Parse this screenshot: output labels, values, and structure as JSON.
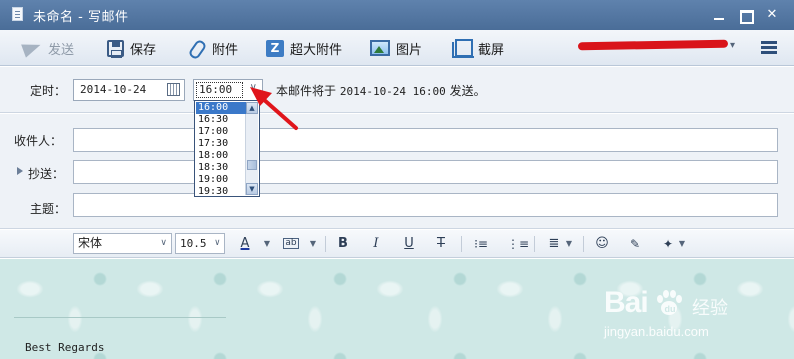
{
  "window": {
    "title": "未命名 - 写邮件"
  },
  "toolbar": {
    "send_label": "发送",
    "save_label": "保存",
    "attach_label": "附件",
    "big_attach_label": "超大附件",
    "picture_label": "图片",
    "screenshot_label": "截屏",
    "big_attach_glyph": "Z"
  },
  "schedule": {
    "label": "定时：",
    "date": "2014-10-24",
    "time": "16:00",
    "note_prefix": "本邮件将于 ",
    "note_datetime": "2014-10-24 16:00",
    "note_suffix": " 发送。",
    "time_options": [
      "16:00",
      "16:30",
      "17:00",
      "17:30",
      "18:00",
      "18:30",
      "19:00",
      "19:30"
    ],
    "selected_index": 0
  },
  "fields": {
    "to_label": "收件人：",
    "cc_label": "抄送：",
    "subject_label": "主题：",
    "to_value": "",
    "cc_value": "",
    "subject_value": ""
  },
  "format": {
    "font_family": "宋体",
    "font_size": "10.5",
    "color_glyph": "A",
    "highlight_glyph": "ab",
    "bold": "B",
    "italic": "I",
    "underline": "U",
    "strike": "T"
  },
  "body": {
    "signature": "Best Regards"
  },
  "watermark": {
    "brand": "Bai",
    "brand_suffix": "du",
    "product": "经验",
    "url": "jingyan.baidu.com"
  },
  "colors": {
    "accent": "#4a6d98",
    "selection": "#3a78c9",
    "annotation_arrow": "#e0151b",
    "body_background": "#cfe8e6"
  }
}
